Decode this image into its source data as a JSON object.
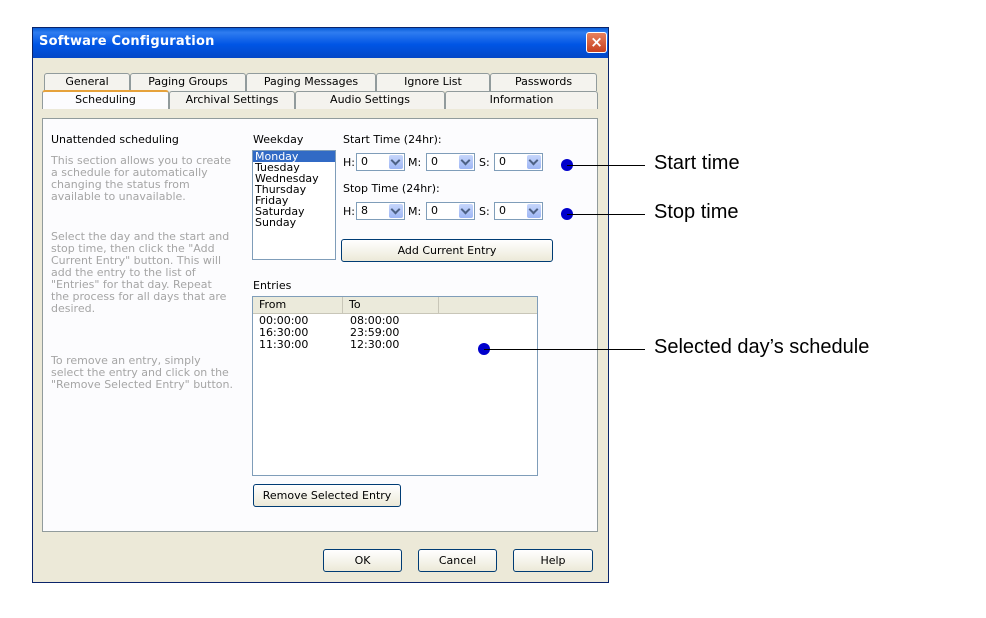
{
  "window": {
    "title": "Software Configuration",
    "close_label": "×"
  },
  "tabs": {
    "row1": [
      "General",
      "Paging Groups",
      "Paging Messages",
      "Ignore List",
      "Passwords"
    ],
    "row2": [
      "Scheduling",
      "Archival Settings",
      "Audio Settings",
      "Information"
    ],
    "active": "Scheduling"
  },
  "scheduling": {
    "heading": "Unattended scheduling",
    "description1": [
      "This section allows you to create",
      "a schedule for automatically",
      "changing the status from",
      "available to unavailable."
    ],
    "description2": [
      "Select the day and the start and",
      "stop time, then click the \"Add",
      "Current Entry\" button.  This will",
      "add the entry to the list of",
      "\"Entries\" for that day.  Repeat",
      "the process for all days that are",
      "desired."
    ],
    "description3": [
      "To remove an entry, simply",
      "select the entry and click on the",
      "\"Remove Selected Entry\" button."
    ],
    "weekday_label": "Weekday",
    "weekdays": [
      "Monday",
      "Tuesday",
      "Wednesday",
      "Thursday",
      "Friday",
      "Saturday",
      "Sunday"
    ],
    "selected_weekday": "Monday",
    "start_time_label": "Start Time (24hr):",
    "stop_time_label": "Stop Time (24hr):",
    "h_label": "H:",
    "m_label": "M:",
    "s_label": "S:",
    "start": {
      "h": "0",
      "m": "0",
      "s": "0"
    },
    "stop": {
      "h": "8",
      "m": "0",
      "s": "0"
    },
    "add_button": "Add Current Entry",
    "entries_label": "Entries",
    "columns": [
      "From",
      "To"
    ],
    "entries": [
      {
        "from": "00:00:00",
        "to": "08:00:00"
      },
      {
        "from": "16:30:00",
        "to": "23:59:00"
      },
      {
        "from": "11:30:00",
        "to": "12:30:00"
      }
    ],
    "remove_button": "Remove Selected Entry"
  },
  "footer": {
    "ok": "OK",
    "cancel": "Cancel",
    "help": "Help"
  },
  "annotations": {
    "start_time": "Start time",
    "stop_time": "Stop time",
    "schedule": "Selected day’s schedule",
    "dot_color": "#0000cc"
  }
}
